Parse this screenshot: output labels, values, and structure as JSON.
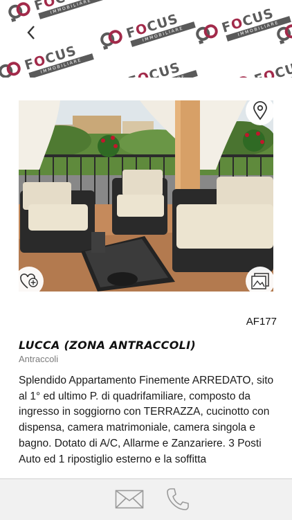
{
  "header": {
    "brand_word_prefix": "F",
    "brand_word_o": "O",
    "brand_word_suffix": "CUS",
    "brand_sub": "IMMOBILIARE",
    "back_icon": "chevron-left-icon",
    "accent_color": "#a22a4a"
  },
  "photo": {
    "map_icon": "map-pin-icon",
    "favorite_icon": "heart-plus-icon",
    "gallery_icon": "image-gallery-icon"
  },
  "listing": {
    "reference": "AF177",
    "title": "LUCCA (ZONA ANTRACCOLI)",
    "subtitle": "Antraccoli",
    "description": "Splendido Appartamento Finemente ARREDATO, sito al 1° ed ultimo P. di quadrifamiliare, composto da ingresso in soggiorno con TERRAZZA, cucinotto con dispensa, camera matrimoniale, camera singola e bagno. Dotato di A/C, Allarme e Zanzariere. 3 Posti Auto ed 1 ripostiglio esterno e la soffitta"
  },
  "bottom_bar": {
    "email_icon": "envelope-icon",
    "phone_icon": "phone-icon"
  }
}
